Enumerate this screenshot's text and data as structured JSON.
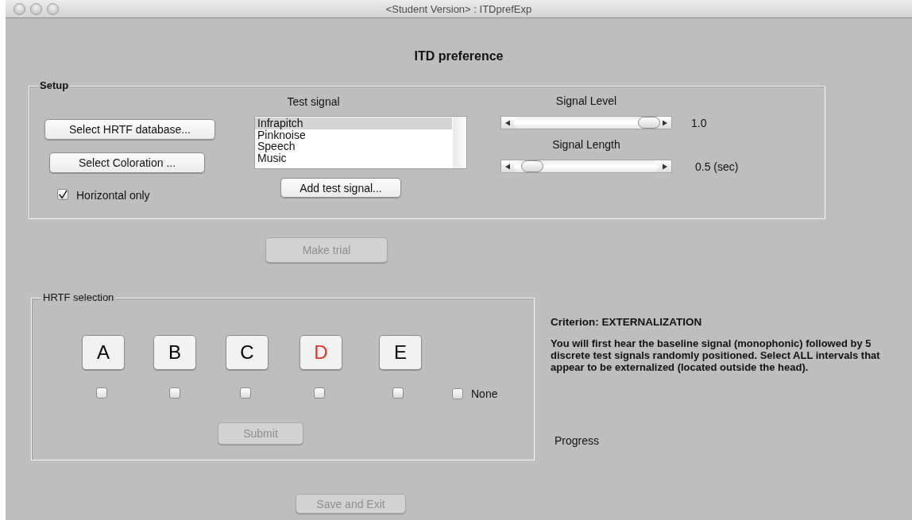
{
  "window": {
    "title": "<Student Version> : ITDprefExp"
  },
  "heading": "ITD preference",
  "setup": {
    "title": "Setup",
    "buttons": [
      {
        "label": "Select HRTF database...",
        "disabled": false
      },
      {
        "label": "Select Coloration ...",
        "disabled": false
      }
    ],
    "horizontal_only": {
      "label": "Horizontal only",
      "checked": true
    },
    "test_signal": {
      "label": "Test signal",
      "items": [
        {
          "label": "Infrapitch",
          "selected": true
        },
        {
          "label": "Pinknoise",
          "selected": false
        },
        {
          "label": "Speech",
          "selected": false
        },
        {
          "label": "Music",
          "selected": false
        }
      ],
      "add_button": "Add test signal..."
    },
    "sliders": [
      {
        "label": "Signal Level",
        "level": 1.0,
        "reading": "1.0"
      },
      {
        "label": "Signal Length",
        "level": 0.06,
        "reading": "0.5 (sec)"
      }
    ]
  },
  "make_trial": {
    "label": "Make trial",
    "disabled": true
  },
  "hrtf_selection": {
    "title": "HRTF selection",
    "options": [
      {
        "label": "A",
        "color": "#000000",
        "checked": false
      },
      {
        "label": "B",
        "color": "#000000",
        "checked": false
      },
      {
        "label": "C",
        "color": "#000000",
        "checked": false
      },
      {
        "label": "D",
        "color": "#e8302a",
        "checked": false
      },
      {
        "label": "E",
        "color": "#000000",
        "checked": false
      }
    ],
    "none": {
      "label": "None",
      "checked": false
    },
    "submit": {
      "label": "Submit",
      "disabled": true
    }
  },
  "criterion": "Criterion: EXTERNALIZATION",
  "instructions": "You will first hear the baseline signal (monophonic) followed by 5 discrete test signals randomly positioned. Select ALL intervals that appear to be externalized (located outside the head).",
  "progress": "Progress",
  "save_exit": {
    "label": "Save and Exit",
    "disabled": true
  }
}
